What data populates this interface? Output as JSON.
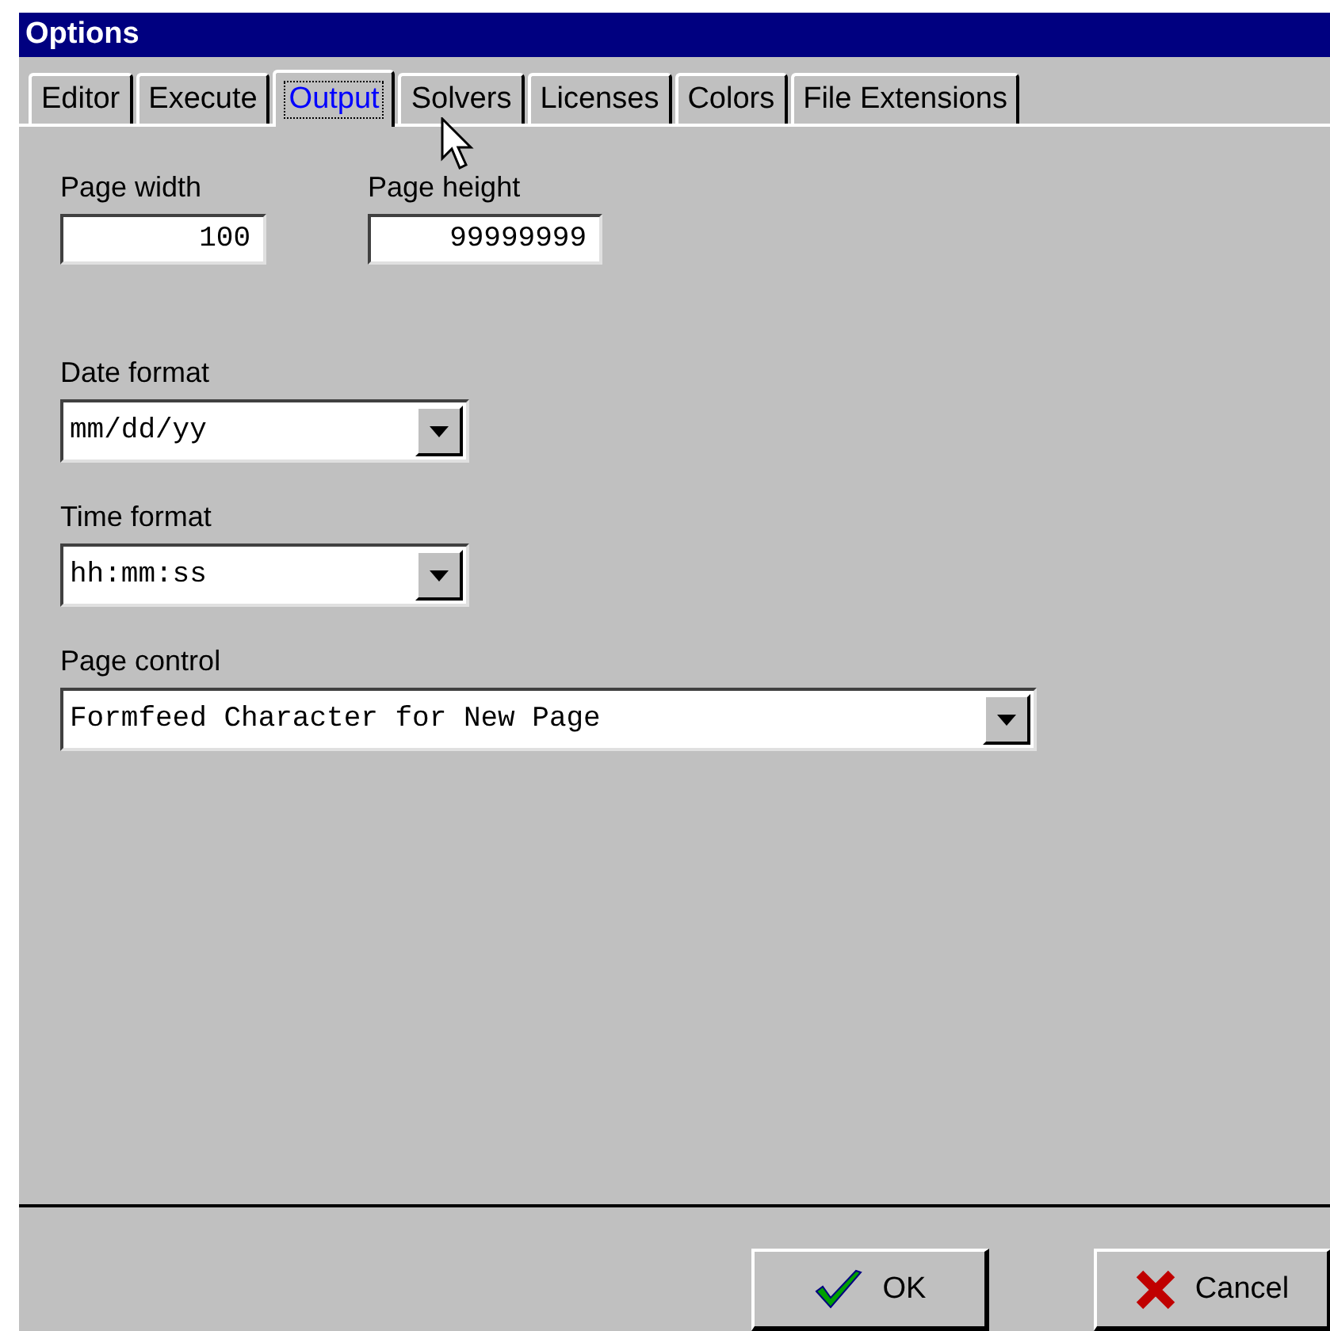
{
  "window": {
    "title": "Options"
  },
  "tabs": [
    {
      "label": "Editor",
      "selected": false
    },
    {
      "label": "Execute",
      "selected": false
    },
    {
      "label": "Output",
      "selected": true
    },
    {
      "label": "Solvers",
      "selected": false
    },
    {
      "label": "Licenses",
      "selected": false
    },
    {
      "label": "Colors",
      "selected": false
    },
    {
      "label": "File Extensions",
      "selected": false
    }
  ],
  "fields": [
    {
      "label": "Page width",
      "value": "100"
    },
    {
      "label": "Page height",
      "value": "99999999"
    }
  ],
  "dropdowns": [
    {
      "label": "Date format",
      "value": "mm/dd/yy",
      "wide": false
    },
    {
      "label": "Time format",
      "value": "hh:mm:ss",
      "wide": false
    },
    {
      "label": "Page control",
      "value": "Formfeed Character for New Page",
      "wide": true
    }
  ],
  "buttons": [
    {
      "label": "OK",
      "kind": "ok"
    },
    {
      "label": "Cancel",
      "kind": "cancel"
    }
  ]
}
